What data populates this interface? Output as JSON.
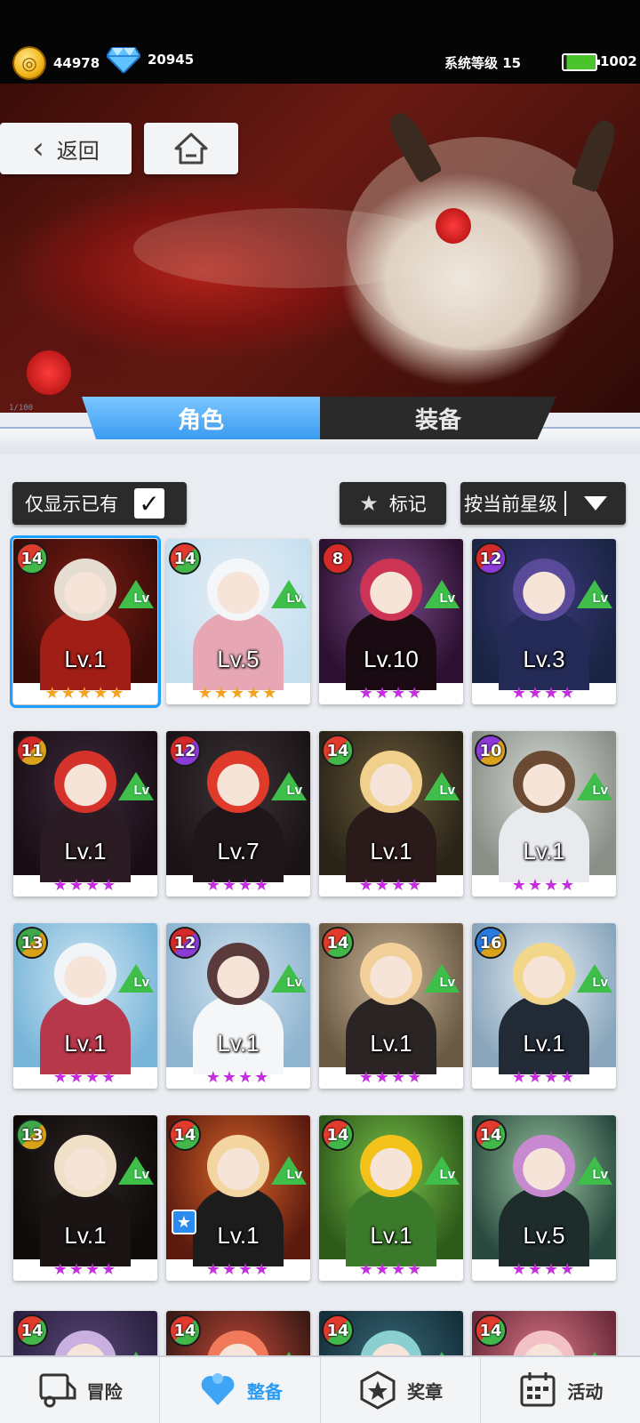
{
  "resources": {
    "coins": "44978",
    "gems": "20945"
  },
  "system": {
    "level_label": "系统等级 15",
    "energy": "1002"
  },
  "nav": {
    "back_label": "返回"
  },
  "tabs": [
    {
      "label": "角色"
    },
    {
      "label": "装备"
    }
  ],
  "decor": {
    "capacity": "1/100"
  },
  "filters": {
    "owned_only": "仅显示已有",
    "owned_checked": "✓",
    "mark": "标记",
    "sort": "按当前星级"
  },
  "cards": [
    {
      "badge": "14",
      "lv": "Lv.1",
      "stars": "★★★★★",
      "rarity": "gold"
    },
    {
      "badge": "14",
      "lv": "Lv.5",
      "stars": "★★★★★",
      "rarity": "gold"
    },
    {
      "badge": "8",
      "lv": "Lv.10",
      "stars": "★★★★",
      "rarity": "purple"
    },
    {
      "badge": "12",
      "lv": "Lv.3",
      "stars": "★★★★",
      "rarity": "purple"
    },
    {
      "badge": "11",
      "lv": "Lv.1",
      "stars": "★★★★",
      "rarity": "purple"
    },
    {
      "badge": "12",
      "lv": "Lv.7",
      "stars": "★★★★",
      "rarity": "purple"
    },
    {
      "badge": "14",
      "lv": "Lv.1",
      "stars": "★★★★",
      "rarity": "purple"
    },
    {
      "badge": "10",
      "lv": "Lv.1",
      "stars": "★★★★",
      "rarity": "purple"
    },
    {
      "badge": "13",
      "lv": "Lv.1",
      "stars": "★★★★",
      "rarity": "purple"
    },
    {
      "badge": "12",
      "lv": "Lv.1",
      "stars": "★★★★",
      "rarity": "purple"
    },
    {
      "badge": "14",
      "lv": "Lv.1",
      "stars": "★★★★",
      "rarity": "purple"
    },
    {
      "badge": "16",
      "lv": "Lv.1",
      "stars": "★★★★",
      "rarity": "purple"
    },
    {
      "badge": "13",
      "lv": "Lv.1",
      "stars": "★★★★",
      "rarity": "purple"
    },
    {
      "badge": "14",
      "lv": "Lv.1",
      "stars": "★★★★",
      "rarity": "purple"
    },
    {
      "badge": "14",
      "lv": "Lv.1",
      "stars": "★★★★",
      "rarity": "purple"
    },
    {
      "badge": "14",
      "lv": "Lv.5",
      "stars": "★★★★",
      "rarity": "purple"
    },
    {
      "badge": "14",
      "lv": "",
      "stars": "",
      "rarity": "purple"
    },
    {
      "badge": "14",
      "lv": "",
      "stars": "",
      "rarity": "purple"
    },
    {
      "badge": "14",
      "lv": "",
      "stars": "",
      "rarity": "purple"
    },
    {
      "badge": "14",
      "lv": "",
      "stars": "",
      "rarity": "purple"
    }
  ],
  "bottom_nav": [
    {
      "label": "冒险",
      "icon": "truck-icon"
    },
    {
      "label": "整备",
      "icon": "heart-gear-icon"
    },
    {
      "label": "奖章",
      "icon": "medal-icon"
    },
    {
      "label": "活动",
      "icon": "calendar-icon"
    }
  ]
}
